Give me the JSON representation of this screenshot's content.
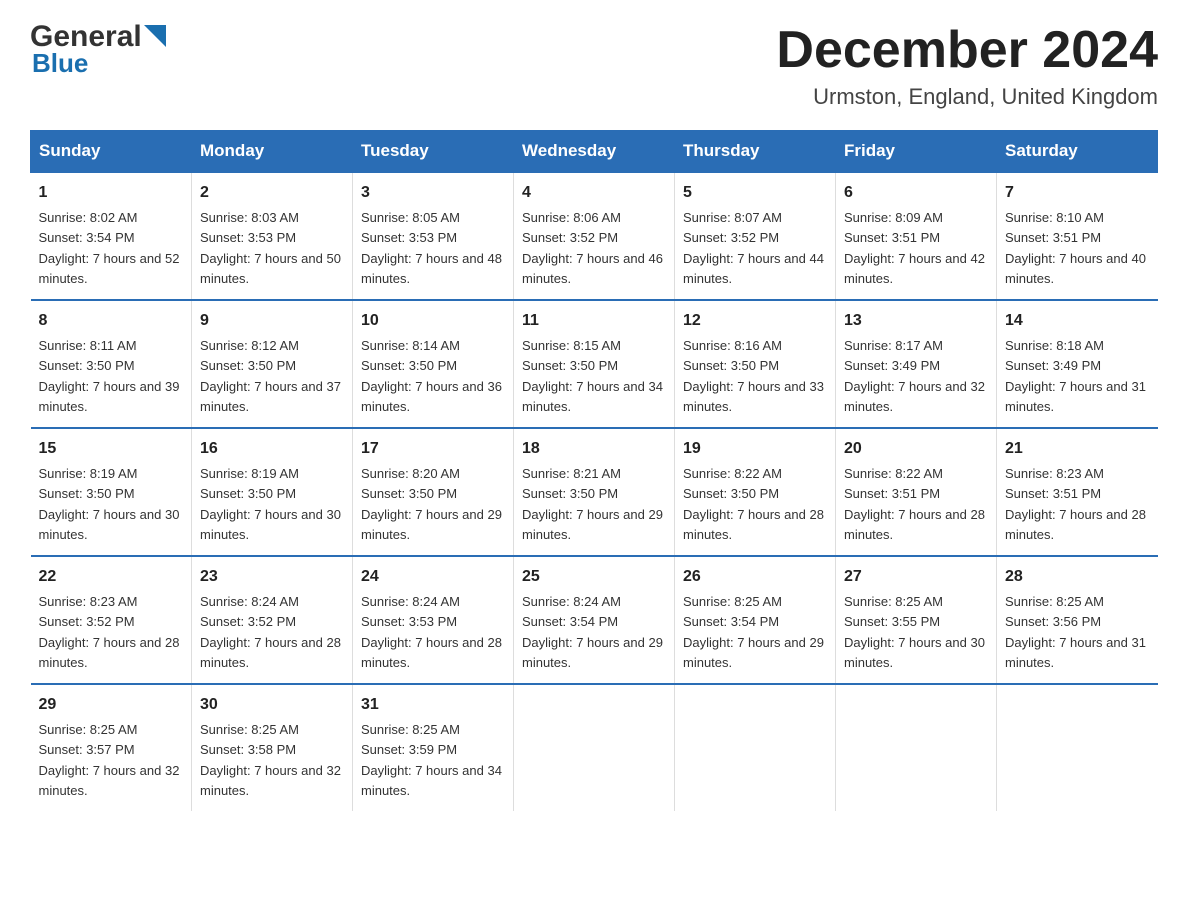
{
  "logo": {
    "general": "General",
    "blue": "Blue"
  },
  "title": "December 2024",
  "location": "Urmston, England, United Kingdom",
  "days_of_week": [
    "Sunday",
    "Monday",
    "Tuesday",
    "Wednesday",
    "Thursday",
    "Friday",
    "Saturday"
  ],
  "weeks": [
    [
      {
        "day": "1",
        "sunrise": "8:02 AM",
        "sunset": "3:54 PM",
        "daylight": "7 hours and 52 minutes."
      },
      {
        "day": "2",
        "sunrise": "8:03 AM",
        "sunset": "3:53 PM",
        "daylight": "7 hours and 50 minutes."
      },
      {
        "day": "3",
        "sunrise": "8:05 AM",
        "sunset": "3:53 PM",
        "daylight": "7 hours and 48 minutes."
      },
      {
        "day": "4",
        "sunrise": "8:06 AM",
        "sunset": "3:52 PM",
        "daylight": "7 hours and 46 minutes."
      },
      {
        "day": "5",
        "sunrise": "8:07 AM",
        "sunset": "3:52 PM",
        "daylight": "7 hours and 44 minutes."
      },
      {
        "day": "6",
        "sunrise": "8:09 AM",
        "sunset": "3:51 PM",
        "daylight": "7 hours and 42 minutes."
      },
      {
        "day": "7",
        "sunrise": "8:10 AM",
        "sunset": "3:51 PM",
        "daylight": "7 hours and 40 minutes."
      }
    ],
    [
      {
        "day": "8",
        "sunrise": "8:11 AM",
        "sunset": "3:50 PM",
        "daylight": "7 hours and 39 minutes."
      },
      {
        "day": "9",
        "sunrise": "8:12 AM",
        "sunset": "3:50 PM",
        "daylight": "7 hours and 37 minutes."
      },
      {
        "day": "10",
        "sunrise": "8:14 AM",
        "sunset": "3:50 PM",
        "daylight": "7 hours and 36 minutes."
      },
      {
        "day": "11",
        "sunrise": "8:15 AM",
        "sunset": "3:50 PM",
        "daylight": "7 hours and 34 minutes."
      },
      {
        "day": "12",
        "sunrise": "8:16 AM",
        "sunset": "3:50 PM",
        "daylight": "7 hours and 33 minutes."
      },
      {
        "day": "13",
        "sunrise": "8:17 AM",
        "sunset": "3:49 PM",
        "daylight": "7 hours and 32 minutes."
      },
      {
        "day": "14",
        "sunrise": "8:18 AM",
        "sunset": "3:49 PM",
        "daylight": "7 hours and 31 minutes."
      }
    ],
    [
      {
        "day": "15",
        "sunrise": "8:19 AM",
        "sunset": "3:50 PM",
        "daylight": "7 hours and 30 minutes."
      },
      {
        "day": "16",
        "sunrise": "8:19 AM",
        "sunset": "3:50 PM",
        "daylight": "7 hours and 30 minutes."
      },
      {
        "day": "17",
        "sunrise": "8:20 AM",
        "sunset": "3:50 PM",
        "daylight": "7 hours and 29 minutes."
      },
      {
        "day": "18",
        "sunrise": "8:21 AM",
        "sunset": "3:50 PM",
        "daylight": "7 hours and 29 minutes."
      },
      {
        "day": "19",
        "sunrise": "8:22 AM",
        "sunset": "3:50 PM",
        "daylight": "7 hours and 28 minutes."
      },
      {
        "day": "20",
        "sunrise": "8:22 AM",
        "sunset": "3:51 PM",
        "daylight": "7 hours and 28 minutes."
      },
      {
        "day": "21",
        "sunrise": "8:23 AM",
        "sunset": "3:51 PM",
        "daylight": "7 hours and 28 minutes."
      }
    ],
    [
      {
        "day": "22",
        "sunrise": "8:23 AM",
        "sunset": "3:52 PM",
        "daylight": "7 hours and 28 minutes."
      },
      {
        "day": "23",
        "sunrise": "8:24 AM",
        "sunset": "3:52 PM",
        "daylight": "7 hours and 28 minutes."
      },
      {
        "day": "24",
        "sunrise": "8:24 AM",
        "sunset": "3:53 PM",
        "daylight": "7 hours and 28 minutes."
      },
      {
        "day": "25",
        "sunrise": "8:24 AM",
        "sunset": "3:54 PM",
        "daylight": "7 hours and 29 minutes."
      },
      {
        "day": "26",
        "sunrise": "8:25 AM",
        "sunset": "3:54 PM",
        "daylight": "7 hours and 29 minutes."
      },
      {
        "day": "27",
        "sunrise": "8:25 AM",
        "sunset": "3:55 PM",
        "daylight": "7 hours and 30 minutes."
      },
      {
        "day": "28",
        "sunrise": "8:25 AM",
        "sunset": "3:56 PM",
        "daylight": "7 hours and 31 minutes."
      }
    ],
    [
      {
        "day": "29",
        "sunrise": "8:25 AM",
        "sunset": "3:57 PM",
        "daylight": "7 hours and 32 minutes."
      },
      {
        "day": "30",
        "sunrise": "8:25 AM",
        "sunset": "3:58 PM",
        "daylight": "7 hours and 32 minutes."
      },
      {
        "day": "31",
        "sunrise": "8:25 AM",
        "sunset": "3:59 PM",
        "daylight": "7 hours and 34 minutes."
      },
      null,
      null,
      null,
      null
    ]
  ]
}
